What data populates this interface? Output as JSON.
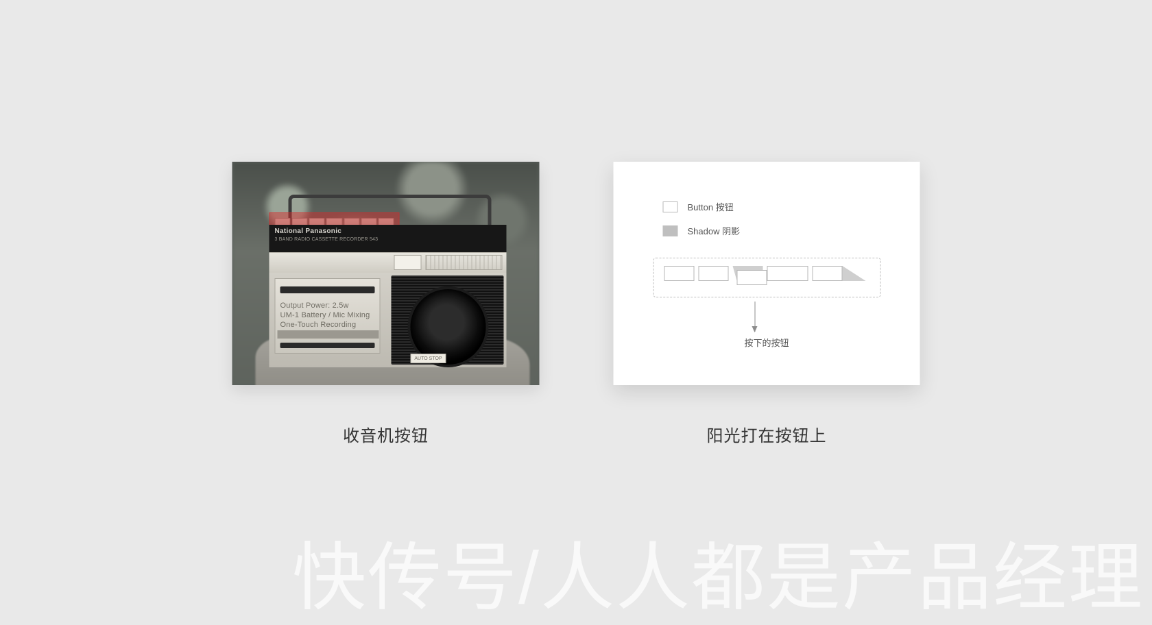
{
  "left": {
    "caption": "收音机按钮",
    "brand": "National Panasonic",
    "subbrand": "3 BAND RADIO CASSETTE RECORDER 543",
    "cassette": {
      "line1": "Output Power: 2.5w",
      "line2": "UM-1 Battery / Mic Mixing",
      "line3": "One-Touch Recording"
    },
    "badge": "AUTO STOP"
  },
  "right": {
    "caption": "阳光打在按钮上",
    "legend": {
      "button": "Button 按钮",
      "shadow": "Shadow 阴影"
    },
    "arrow_label": "按下的按钮"
  },
  "watermark": "快传号/人人都是产品经理"
}
